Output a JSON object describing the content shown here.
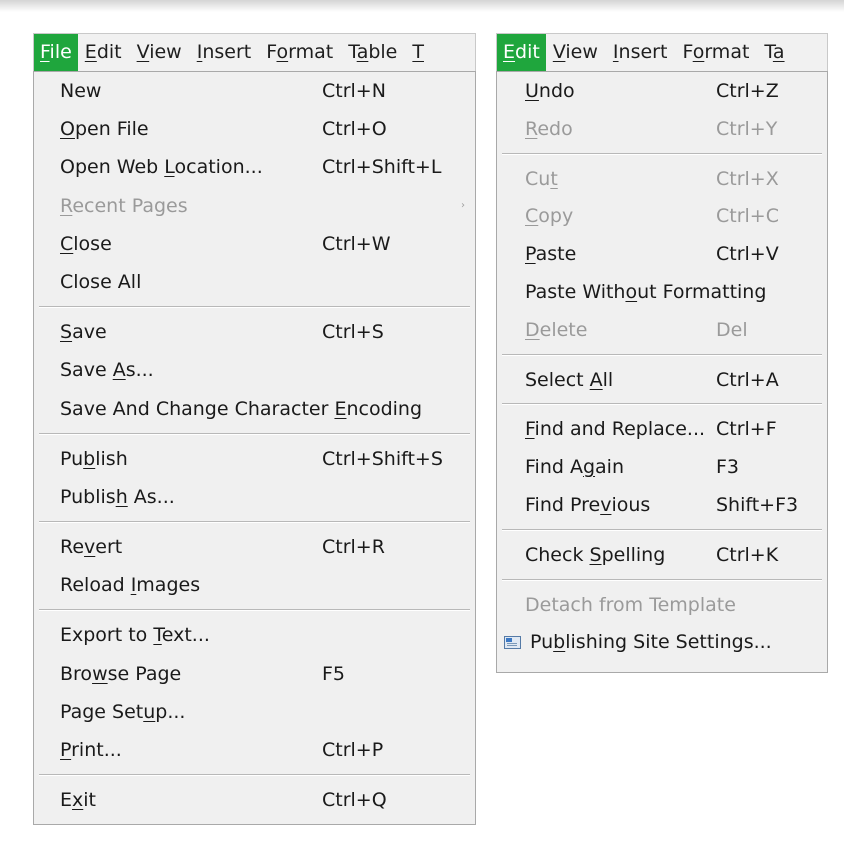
{
  "file_panel": {
    "menubar": [
      {
        "pre": "",
        "acc": "F",
        "post": "ile",
        "active": true
      },
      {
        "pre": "",
        "acc": "E",
        "post": "dit",
        "active": false
      },
      {
        "pre": "",
        "acc": "V",
        "post": "iew",
        "active": false
      },
      {
        "pre": "",
        "acc": "I",
        "post": "nsert",
        "active": false
      },
      {
        "pre": "F",
        "acc": "o",
        "post": "rmat",
        "active": false
      },
      {
        "pre": "T",
        "acc": "a",
        "post": "ble",
        "active": false
      },
      {
        "pre": "",
        "acc": "T",
        "post": "",
        "active": false
      }
    ],
    "menu": [
      {
        "type": "item",
        "pre": "New",
        "acc": "",
        "post": "",
        "shortcut": "Ctrl+N",
        "disabled": false
      },
      {
        "type": "item",
        "pre": "",
        "acc": "O",
        "post": "pen File",
        "shortcut": "Ctrl+O",
        "disabled": false
      },
      {
        "type": "item",
        "pre": "Open Web ",
        "acc": "L",
        "post": "ocation...",
        "shortcut": "Ctrl+Shift+L",
        "disabled": false
      },
      {
        "type": "item",
        "pre": "",
        "acc": "R",
        "post": "ecent Pages",
        "shortcut": "",
        "disabled": true,
        "submenu": true,
        "arrow": "›"
      },
      {
        "type": "item",
        "pre": "",
        "acc": "C",
        "post": "lose",
        "shortcut": "Ctrl+W",
        "disabled": false
      },
      {
        "type": "item",
        "pre": "Close All",
        "acc": "",
        "post": "",
        "shortcut": "",
        "disabled": false
      },
      {
        "type": "separator"
      },
      {
        "type": "item",
        "pre": "",
        "acc": "S",
        "post": "ave",
        "shortcut": "Ctrl+S",
        "disabled": false
      },
      {
        "type": "item",
        "pre": "Save ",
        "acc": "A",
        "post": "s...",
        "shortcut": "",
        "disabled": false
      },
      {
        "type": "item",
        "pre": "Save And Change Character ",
        "acc": "E",
        "post": "ncoding",
        "shortcut": "",
        "disabled": false
      },
      {
        "type": "separator"
      },
      {
        "type": "item",
        "pre": "Pu",
        "acc": "b",
        "post": "lish",
        "shortcut": "Ctrl+Shift+S",
        "disabled": false
      },
      {
        "type": "item",
        "pre": "Publis",
        "acc": "h",
        "post": " As...",
        "shortcut": "",
        "disabled": false
      },
      {
        "type": "separator"
      },
      {
        "type": "item",
        "pre": "Re",
        "acc": "v",
        "post": "ert",
        "shortcut": "Ctrl+R",
        "disabled": false
      },
      {
        "type": "item",
        "pre": "Reload ",
        "acc": "I",
        "post": "mages",
        "shortcut": "",
        "disabled": false
      },
      {
        "type": "separator"
      },
      {
        "type": "item",
        "pre": "Export to ",
        "acc": "T",
        "post": "ext...",
        "shortcut": "",
        "disabled": false
      },
      {
        "type": "item",
        "pre": "Bro",
        "acc": "w",
        "post": "se Page",
        "shortcut": "F5",
        "disabled": false
      },
      {
        "type": "item",
        "pre": "Page Set",
        "acc": "u",
        "post": "p...",
        "shortcut": "",
        "disabled": false
      },
      {
        "type": "item",
        "pre": "",
        "acc": "P",
        "post": "rint...",
        "shortcut": "Ctrl+P",
        "disabled": false
      },
      {
        "type": "separator"
      },
      {
        "type": "item",
        "pre": "E",
        "acc": "x",
        "post": "it",
        "shortcut": "Ctrl+Q",
        "disabled": false
      }
    ]
  },
  "edit_panel": {
    "menubar": [
      {
        "pre": "",
        "acc": "E",
        "post": "dit",
        "active": true
      },
      {
        "pre": "",
        "acc": "V",
        "post": "iew",
        "active": false
      },
      {
        "pre": "",
        "acc": "I",
        "post": "nsert",
        "active": false
      },
      {
        "pre": "F",
        "acc": "o",
        "post": "rmat",
        "active": false
      },
      {
        "pre": "T",
        "acc": "a",
        "post": "",
        "active": false
      }
    ],
    "menu": [
      {
        "type": "item",
        "pre": "",
        "acc": "U",
        "post": "ndo",
        "shortcut": "Ctrl+Z",
        "disabled": false
      },
      {
        "type": "item",
        "pre": "",
        "acc": "R",
        "post": "edo",
        "shortcut": "Ctrl+Y",
        "disabled": true
      },
      {
        "type": "separator"
      },
      {
        "type": "item",
        "pre": "Cu",
        "acc": "t",
        "post": "",
        "shortcut": "Ctrl+X",
        "disabled": true
      },
      {
        "type": "item",
        "pre": "",
        "acc": "C",
        "post": "opy",
        "shortcut": "Ctrl+C",
        "disabled": true
      },
      {
        "type": "item",
        "pre": "",
        "acc": "P",
        "post": "aste",
        "shortcut": "Ctrl+V",
        "disabled": false
      },
      {
        "type": "item",
        "pre": "Paste With",
        "acc": "o",
        "post": "ut Formatting",
        "shortcut": "",
        "disabled": false
      },
      {
        "type": "item",
        "pre": "",
        "acc": "D",
        "post": "elete",
        "shortcut": "Del",
        "disabled": true
      },
      {
        "type": "separator"
      },
      {
        "type": "item",
        "pre": "Select ",
        "acc": "A",
        "post": "ll",
        "shortcut": "Ctrl+A",
        "disabled": false
      },
      {
        "type": "separator"
      },
      {
        "type": "item",
        "pre": "",
        "acc": "F",
        "post": "ind and Replace...",
        "shortcut": "Ctrl+F",
        "disabled": false
      },
      {
        "type": "item",
        "pre": "Find A",
        "acc": "g",
        "post": "ain",
        "shortcut": "F3",
        "disabled": false
      },
      {
        "type": "item",
        "pre": "Find Pre",
        "acc": "v",
        "post": "ious",
        "shortcut": "Shift+F3",
        "disabled": false
      },
      {
        "type": "separator"
      },
      {
        "type": "item",
        "pre": "Check ",
        "acc": "S",
        "post": "pelling",
        "shortcut": "Ctrl+K",
        "disabled": false
      },
      {
        "type": "separator"
      },
      {
        "type": "item",
        "pre": "Detach from Template",
        "acc": "",
        "post": "",
        "shortcut": "",
        "disabled": true
      },
      {
        "type": "item",
        "pre": "Pu",
        "acc": "b",
        "post": "lishing Site Settings...",
        "shortcut": "",
        "disabled": false,
        "icon": "site-settings-icon"
      }
    ]
  },
  "colors": {
    "active_menu": "#1fa63d",
    "disabled_text": "#9a9a9a",
    "menu_bg": "#f0f0f0"
  }
}
